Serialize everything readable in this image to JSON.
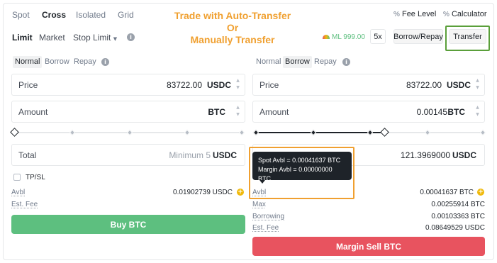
{
  "top_tabs": [
    "Spot",
    "Cross",
    "Isolated",
    "Grid"
  ],
  "banner": {
    "line1": "Trade with Auto-Transfer",
    "line2": "Or",
    "line3": "Manually Transfer"
  },
  "top_right": {
    "fee_level": "Fee Level",
    "calculator": "Calculator"
  },
  "order_types": {
    "limit": "Limit",
    "market": "Market",
    "stop_limit": "Stop Limit"
  },
  "account": {
    "ml_value": "ML 999.00",
    "leverage": "5x",
    "borrow_repay": "Borrow/Repay",
    "transfer": "Transfer"
  },
  "buy_panel": {
    "modes": [
      "Normal",
      "Borrow",
      "Repay"
    ],
    "price_label": "Price",
    "price_value": "83722.00",
    "price_unit": "USDC",
    "amount_label": "Amount",
    "amount_unit": "BTC",
    "total_label": "Total",
    "total_hint": "Minimum 5",
    "total_unit": "USDC",
    "tpsl": "TP/SL",
    "avbl_label": "Avbl",
    "avbl_value": "0.01902739 USDC",
    "est_fee_label": "Est. Fee",
    "button": "Buy BTC"
  },
  "sell_panel": {
    "modes": [
      "Normal",
      "Borrow",
      "Repay"
    ],
    "price_label": "Price",
    "price_value": "83722.00",
    "price_unit": "USDC",
    "amount_label": "Amount",
    "amount_value": "0.00145",
    "amount_unit": "BTC",
    "total_value": "121.3969000",
    "total_unit": "USDC",
    "tooltip_spot": "Spot Avbl = 0.00041637 BTC",
    "tooltip_margin": "Margin Avbl = 0.00000000 BTC",
    "avbl_label": "Avbl",
    "avbl_value": "0.00041637 BTC",
    "max_label": "Max",
    "max_value": "0.00255914 BTC",
    "borrowing_label": "Borrowing",
    "borrowing_value": "0.00103363 BTC",
    "est_fee_label": "Est. Fee",
    "est_fee_value": "0.08649529 USDC",
    "button": "Margin Sell BTC"
  },
  "colors": {
    "buy": "#5dbf7f",
    "sell": "#e8535f",
    "highlight_orange": "#f0a030",
    "highlight_green": "#5a9f3a"
  }
}
